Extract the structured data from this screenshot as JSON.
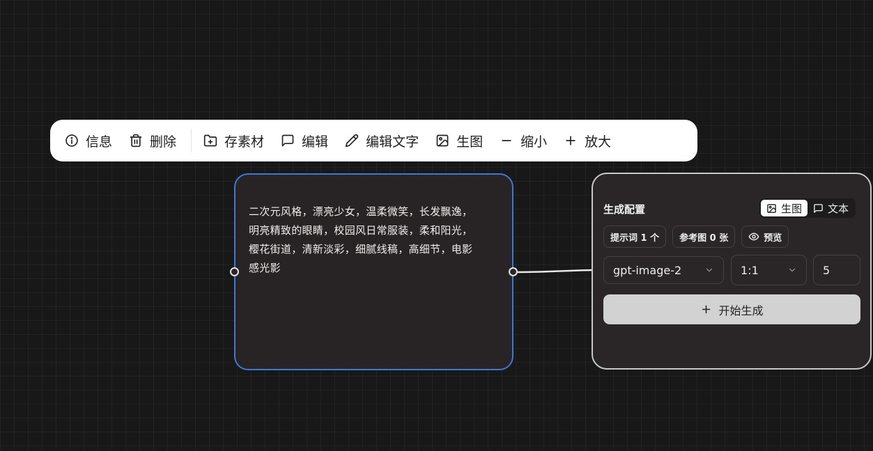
{
  "toolbar": {
    "items": [
      {
        "label": "信息",
        "icon": "info-icon"
      },
      {
        "label": "删除",
        "icon": "trash-icon"
      },
      {
        "label": "存素材",
        "icon": "folder-plus-icon"
      },
      {
        "label": "编辑",
        "icon": "message-square-icon"
      },
      {
        "label": "编辑文字",
        "icon": "pencil-icon"
      },
      {
        "label": "生图",
        "icon": "image-icon"
      },
      {
        "label": "缩小",
        "icon": "minus-icon"
      },
      {
        "label": "放大",
        "icon": "plus-icon"
      }
    ]
  },
  "text_node": {
    "lines": [
      "二次元风格，漂亮少女，温柔微笑，长发飘逸，",
      "明亮精致的眼睛，校园风日常服装，柔和阳光，",
      "樱花街道，清新淡彩，细腻线稿，高细节，电影",
      "感光影"
    ]
  },
  "config": {
    "title": "生成配置",
    "mode_image": "生图",
    "mode_text": "文本",
    "chip_prompts": "提示词 1 个",
    "chip_refs": "参考图 0 张",
    "chip_preview": "预览",
    "model": "gpt-image-2",
    "ratio": "1:1",
    "count": "5",
    "generate_label": "开始生成"
  },
  "colors": {
    "selected_border": "#3f79d8",
    "canvas_bg": "#181818",
    "node_bg": "#282425"
  }
}
